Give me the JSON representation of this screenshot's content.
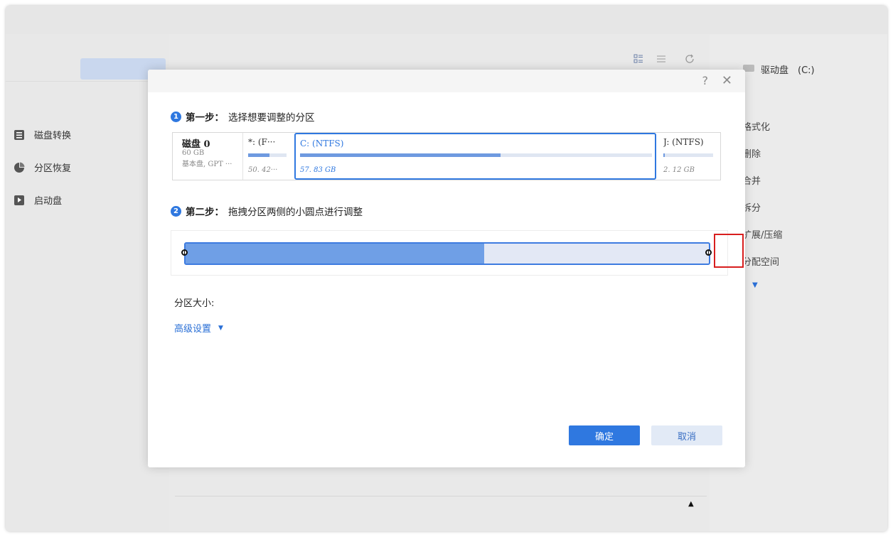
{
  "sidebar": {
    "items": [
      {
        "label": "磁盘转换",
        "icon": "disk-convert-icon"
      },
      {
        "label": "分区恢复",
        "icon": "partition-recovery-icon"
      },
      {
        "label": "启动盘",
        "icon": "boot-disk-icon"
      }
    ]
  },
  "toolbar": {
    "icons": [
      "grid-view-icon",
      "list-view-icon",
      "refresh-icon"
    ]
  },
  "right_panel": {
    "drive_label": "驱动盘　(C:)",
    "actions": [
      "格式化",
      "删除",
      "合并",
      "拆分",
      "扩展/压缩",
      "分配空间"
    ]
  },
  "dialog": {
    "help_label": "?",
    "close_label": "✕",
    "step1": {
      "num": "1",
      "title": "第一步：",
      "text": "选择想要调整的分区"
    },
    "disk": {
      "name": "磁盘 0",
      "size": "60 GB",
      "type": "基本盘, GPT ···",
      "partitions": [
        {
          "label": "*: (F···",
          "size": "50. 42···",
          "used": 0.55,
          "selected": false
        },
        {
          "label": "C: (NTFS)",
          "size": "57. 83 GB",
          "used": 0.57,
          "selected": true
        },
        {
          "label": "J: (NTFS)",
          "size": "2. 12 GB",
          "used": 0.03,
          "selected": false
        }
      ]
    },
    "step2": {
      "num": "2",
      "title": "第二步：",
      "text": "拖拽分区两侧的小圆点进行调整"
    },
    "resize": {
      "used_fraction": 0.57
    },
    "size_label": "分区大小:",
    "advanced_label": "高级设置",
    "ok_label": "确定",
    "cancel_label": "取消"
  },
  "colors": {
    "accent": "#2f78e0",
    "highlight": "#d81e1e"
  }
}
